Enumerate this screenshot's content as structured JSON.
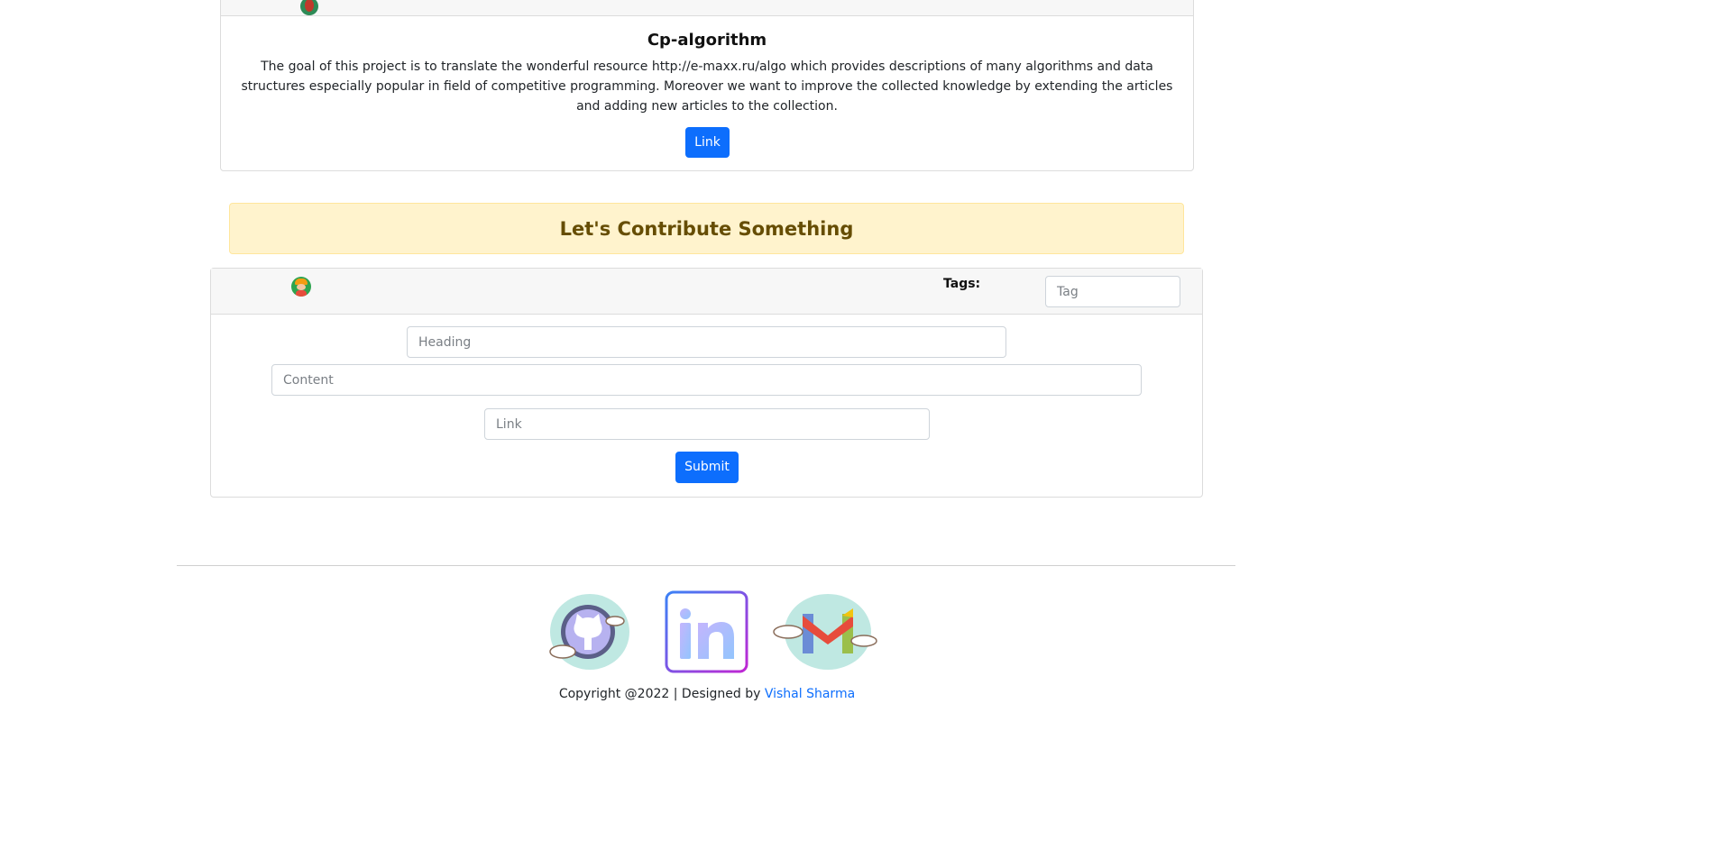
{
  "project_card": {
    "title": "Cp-algorithm",
    "description": "The goal of this project is to translate the wonderful resource http://e-maxx.ru/algo which provides descriptions of many algorithms and data structures especially popular in field of competitive programming. Moreover we want to improve the collected knowledge by extending the articles and adding new articles to the collection.",
    "link_label": "Link"
  },
  "contribute": {
    "banner": "Let's Contribute Something",
    "tags_label": "Tags:",
    "tag_placeholder": "Tag",
    "heading_placeholder": "Heading",
    "content_placeholder": "Content",
    "link_placeholder": "Link",
    "submit_label": "Submit"
  },
  "footer": {
    "copyright": "Copyright @2022 | Designed by ",
    "designer": "Vishal Sharma",
    "social_icons": [
      "github-icon",
      "linkedin-icon",
      "gmail-icon"
    ]
  }
}
